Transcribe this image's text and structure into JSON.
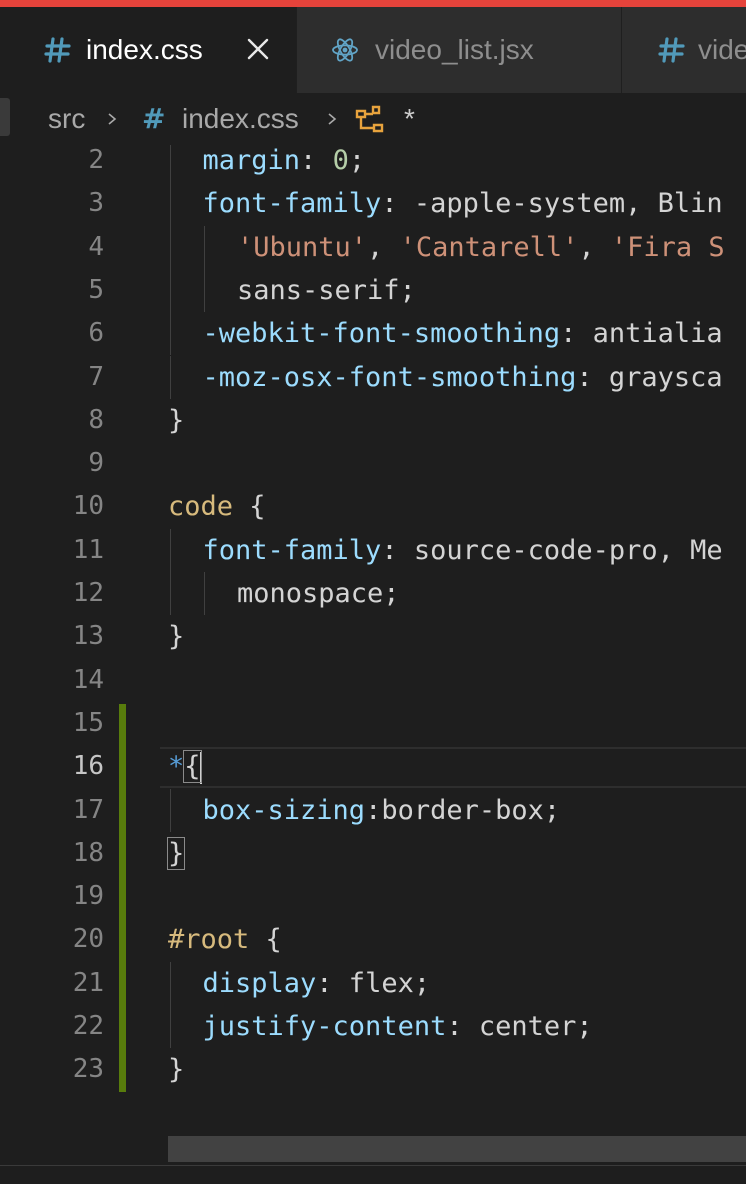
{
  "tabs": [
    {
      "label": "index.css",
      "icon": "css-hash-icon",
      "active": true
    },
    {
      "label": "video_list.jsx",
      "icon": "react-icon",
      "active": false
    },
    {
      "label": "vide",
      "icon": "css-hash-icon",
      "active": false
    }
  ],
  "breadcrumb": {
    "folder": "src",
    "file_hash": "#",
    "file": "index.css",
    "symbol": "*"
  },
  "editor": {
    "current_line": "16",
    "lines": [
      {
        "no": "2",
        "indent": 1,
        "tokens": [
          {
            "t": "margin",
            "c": "p"
          },
          {
            "t": ": ",
            "c": "w"
          },
          {
            "t": "0",
            "c": "n"
          },
          {
            "t": ";",
            "c": "w"
          }
        ]
      },
      {
        "no": "3",
        "indent": 1,
        "tokens": [
          {
            "t": "font-family",
            "c": "p"
          },
          {
            "t": ": -apple-system, Blin",
            "c": "w"
          }
        ]
      },
      {
        "no": "4",
        "indent": 2,
        "tokens": [
          {
            "t": "'Ubuntu'",
            "c": "s"
          },
          {
            "t": ", ",
            "c": "w"
          },
          {
            "t": "'Cantarell'",
            "c": "s"
          },
          {
            "t": ", ",
            "c": "w"
          },
          {
            "t": "'Fira S",
            "c": "s"
          }
        ]
      },
      {
        "no": "5",
        "indent": 2,
        "tokens": [
          {
            "t": "sans-serif;",
            "c": "w"
          }
        ]
      },
      {
        "no": "6",
        "indent": 1,
        "tokens": [
          {
            "t": "-webkit-font-smoothing",
            "c": "p"
          },
          {
            "t": ": antialia",
            "c": "w"
          }
        ]
      },
      {
        "no": "7",
        "indent": 1,
        "tokens": [
          {
            "t": "-moz-osx-font-smoothing",
            "c": "p"
          },
          {
            "t": ": graysca",
            "c": "w"
          }
        ]
      },
      {
        "no": "8",
        "indent": 0,
        "tokens": [
          {
            "t": "}",
            "c": "w"
          }
        ]
      },
      {
        "no": "9",
        "indent": 0,
        "tokens": []
      },
      {
        "no": "10",
        "indent": 0,
        "tokens": [
          {
            "t": "code",
            "c": "sel"
          },
          {
            "t": " {",
            "c": "w"
          }
        ]
      },
      {
        "no": "11",
        "indent": 1,
        "tokens": [
          {
            "t": "font-family",
            "c": "p"
          },
          {
            "t": ": source-code-pro, Me",
            "c": "w"
          }
        ]
      },
      {
        "no": "12",
        "indent": 2,
        "tokens": [
          {
            "t": "monospace;",
            "c": "w"
          }
        ]
      },
      {
        "no": "13",
        "indent": 0,
        "tokens": [
          {
            "t": "}",
            "c": "w"
          }
        ]
      },
      {
        "no": "14",
        "indent": 0,
        "tokens": []
      },
      {
        "no": "15",
        "indent": 0,
        "tokens": []
      },
      {
        "no": "16",
        "indent": 0,
        "tokens": [
          {
            "t": "*",
            "c": "u"
          },
          {
            "t": "{",
            "c": "w",
            "match": true,
            "cursor": true
          }
        ]
      },
      {
        "no": "17",
        "indent": 1,
        "tokens": [
          {
            "t": "box-sizing",
            "c": "p"
          },
          {
            "t": ":border-box;",
            "c": "w"
          }
        ]
      },
      {
        "no": "18",
        "indent": 0,
        "tokens": [
          {
            "t": "}",
            "c": "w",
            "match": true
          }
        ]
      },
      {
        "no": "19",
        "indent": 0,
        "tokens": []
      },
      {
        "no": "20",
        "indent": 0,
        "tokens": [
          {
            "t": "#root",
            "c": "sel"
          },
          {
            "t": " {",
            "c": "w"
          }
        ]
      },
      {
        "no": "21",
        "indent": 1,
        "tokens": [
          {
            "t": "display",
            "c": "p"
          },
          {
            "t": ": flex;",
            "c": "w"
          }
        ]
      },
      {
        "no": "22",
        "indent": 1,
        "tokens": [
          {
            "t": "justify-content",
            "c": "p"
          },
          {
            "t": ": center;",
            "c": "w"
          }
        ]
      },
      {
        "no": "23",
        "indent": 0,
        "tokens": [
          {
            "t": "}",
            "c": "w"
          }
        ]
      }
    ]
  },
  "colors": {
    "accent_bar": "#e5433b",
    "modified_gutter": "#587c0c",
    "property": "#9cdcfe",
    "string": "#ce9178",
    "number": "#b5cea8",
    "selector": "#d7ba7d"
  }
}
